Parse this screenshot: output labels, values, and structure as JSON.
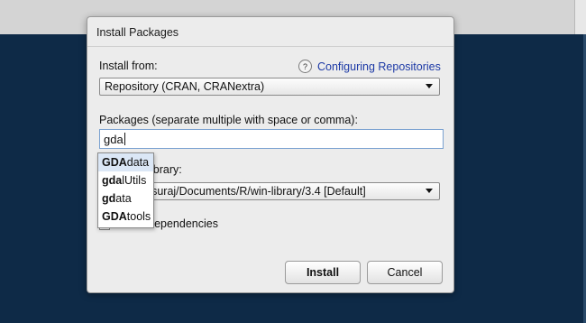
{
  "dialog": {
    "title": "Install Packages",
    "install_from_label": "Install from:",
    "help_link": "Configuring Repositories",
    "install_from_value": "Repository (CRAN, CRANextra)",
    "packages_label": "Packages (separate multiple with space or comma):",
    "packages_value": "gda",
    "library_label": "Install to Library:",
    "library_value": "C:/Users/suraj/Documents/R/win-library/3.4 [Default]",
    "dependencies_label": "Install dependencies",
    "install_button": "Install",
    "cancel_button": "Cancel"
  },
  "autocomplete": {
    "items": [
      {
        "match": "GDA",
        "rest": "data"
      },
      {
        "match": "gda",
        "rest": "lUtils"
      },
      {
        "match": "gd",
        "rest": "ata"
      },
      {
        "match": "GDA",
        "rest": "tools"
      }
    ]
  },
  "icons": {
    "help": "?"
  }
}
